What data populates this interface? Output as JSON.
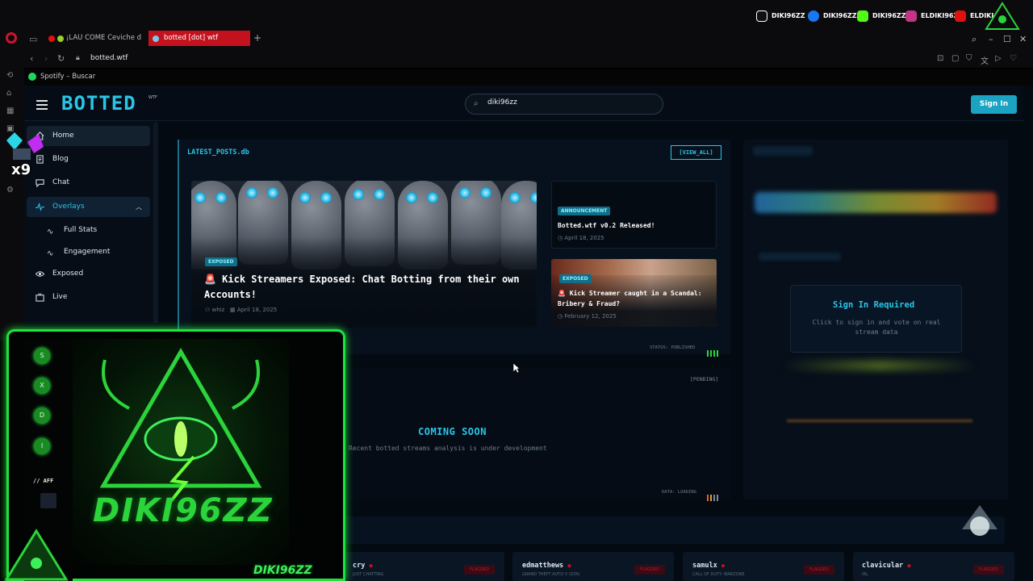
{
  "browser": {
    "tabs": [
      {
        "label": "¡LAU COME Ceviche d",
        "active": false
      },
      {
        "label": "botted [dot] wtf",
        "active": true
      }
    ],
    "url": "botted.wtf",
    "bookmark": "Spotify – Buscar"
  },
  "stream_socials": [
    {
      "platform": "tiktok-icon",
      "handle": "DIKI96ZZ"
    },
    {
      "platform": "facebook-icon",
      "handle": "DIKI96ZZ"
    },
    {
      "platform": "kick-icon",
      "handle": "DIKI96ZZ"
    },
    {
      "platform": "instagram-icon",
      "handle": "ELDIKI96ZZ"
    },
    {
      "platform": "youtube-icon",
      "handle": "ELDIKI"
    }
  ],
  "site": {
    "logo": "BOTTED",
    "logo_sup": "WTF",
    "search_value": "diki96zz",
    "signin": "Sign In",
    "accent": "#29c6e8"
  },
  "sidebar": {
    "items": [
      {
        "label": "Home",
        "icon": "home-icon"
      },
      {
        "label": "Blog",
        "icon": "document-icon"
      },
      {
        "label": "Chat",
        "icon": "chat-icon"
      },
      {
        "label": "Overlays",
        "icon": "pulse-icon"
      },
      {
        "label": "Exposed",
        "icon": "eye-icon"
      },
      {
        "label": "Live",
        "icon": "tv-icon"
      }
    ],
    "subitems": [
      {
        "label": "Full Stats",
        "icon": "pulse-icon"
      },
      {
        "label": "Engagement",
        "icon": "pulse-icon"
      }
    ]
  },
  "latest_posts": {
    "title": "LATEST_POSTS.db",
    "view_all": "[VIEW_ALL]",
    "hero": {
      "badge": "EXPOSED",
      "title": "🚨 Kick Streamers Exposed: Chat Botting from their own Accounts!",
      "author": "whiz",
      "date": "April 18, 2025"
    },
    "cards": [
      {
        "badge": "ANNOUNCEMENT",
        "title": "Botted.wtf v0.2 Released!",
        "date": "April 18, 2025"
      },
      {
        "badge": "EXPOSED",
        "title": "🚨 Kick Streamer caught in a Scandal: Bribery & Fraud?",
        "date": "February 12, 2025"
      }
    ],
    "status": "STATUS: PUBLISHED"
  },
  "analysis": {
    "pending": "[PENDING]",
    "title": "COMING SOON",
    "subtitle": "Recent botted streams analysis is under development",
    "status": "DATA: LOADING"
  },
  "signin_box": {
    "title": "Sign In Required",
    "subtitle": "Click to sign in and vote on real stream data"
  },
  "streamers": [
    {
      "name": "cry",
      "game": "JUST CHATTING",
      "flag": "FLAGGED"
    },
    {
      "name": "edmatthews",
      "game": "GRAND THEFT AUTO V (GTA)",
      "flag": "FLAGGED"
    },
    {
      "name": "samulx",
      "game": "CALL OF DUTY: WARZONE",
      "flag": "FLAGGED"
    },
    {
      "name": "clavicular",
      "game": "IRL",
      "flag": "FLAGGED"
    }
  ],
  "overlay": {
    "letters": [
      "S",
      "X",
      "D",
      "I"
    ],
    "aff": "// AFF",
    "name": "DIKI96ZZ",
    "tag": "DIKI96ZZ",
    "multiplier": "x9",
    "neon": "#1ee33b"
  }
}
